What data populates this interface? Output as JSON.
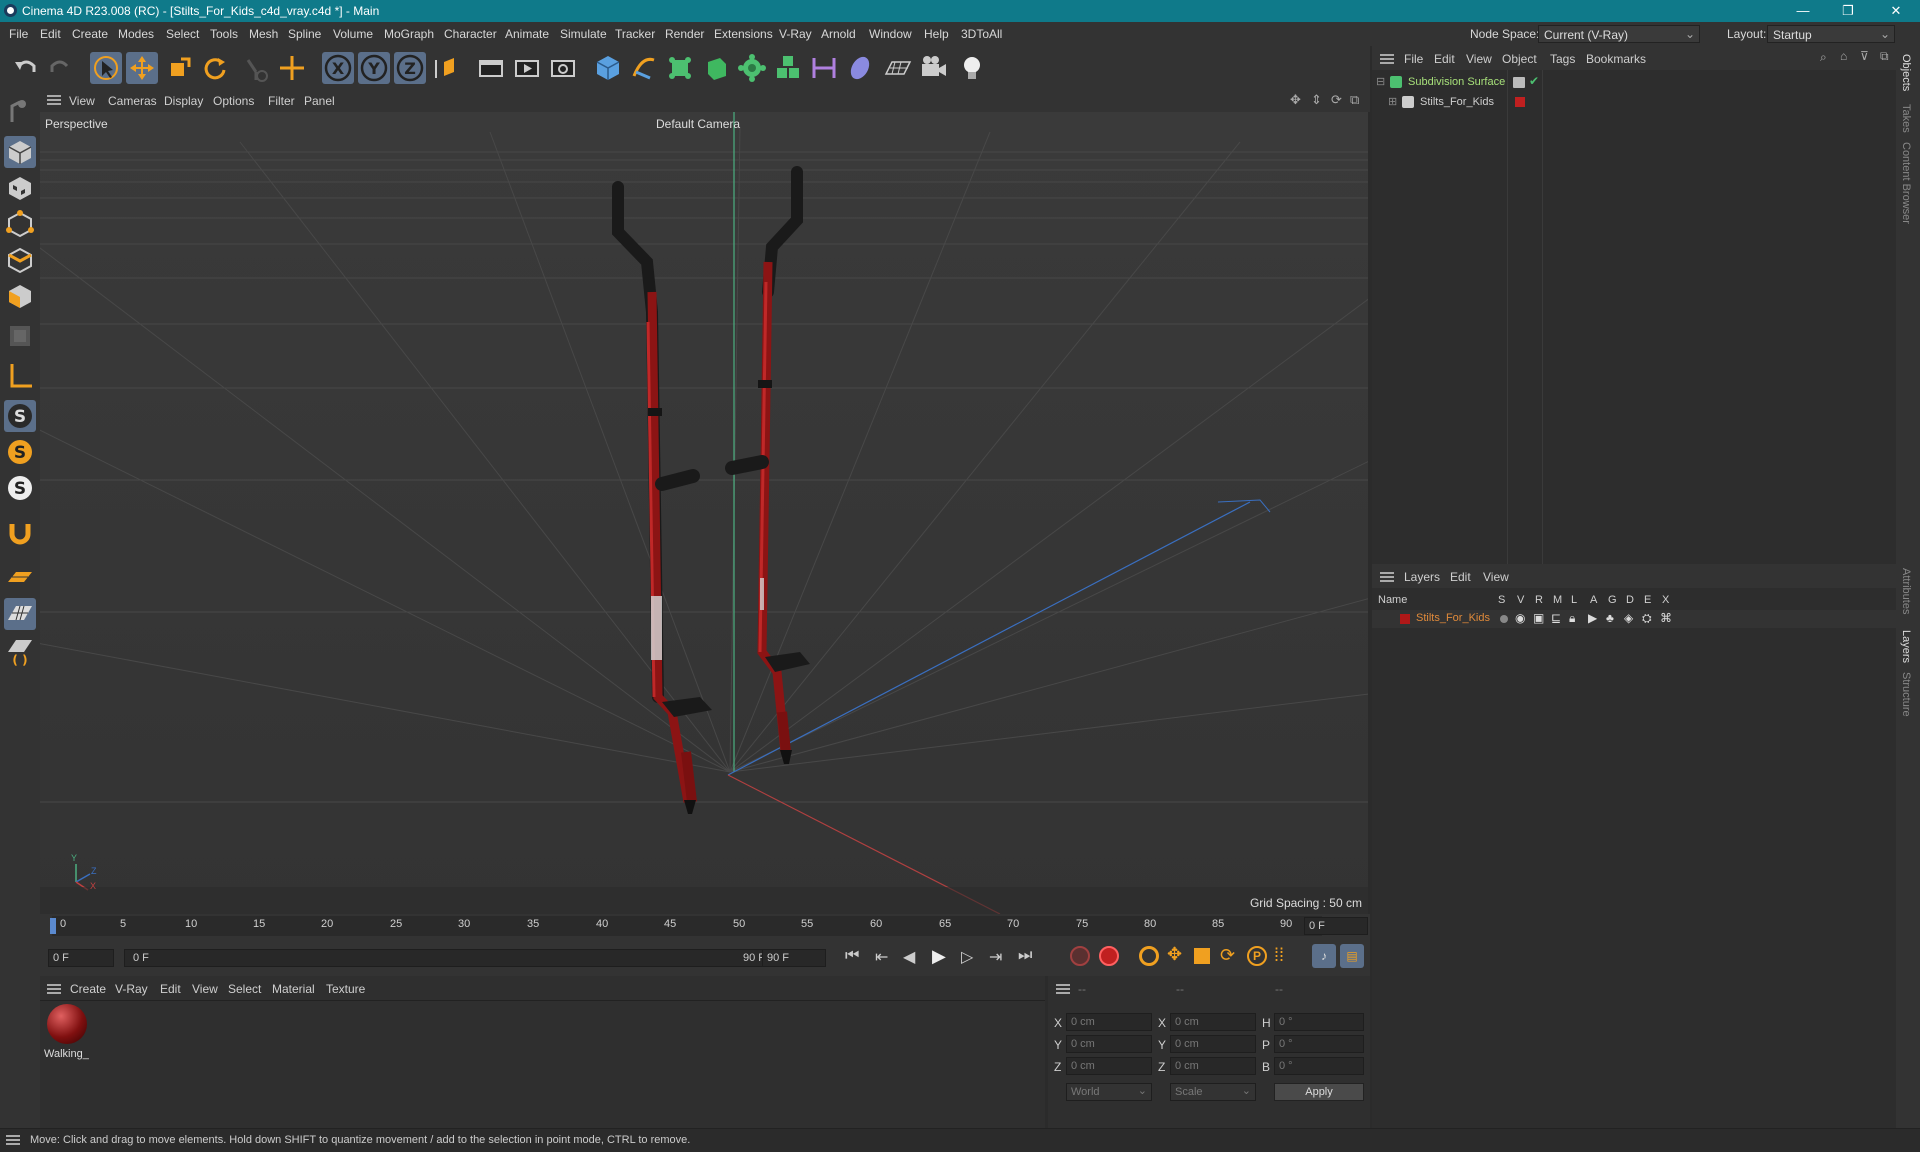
{
  "window": {
    "title": "Cinema 4D R23.008 (RC) - [Stilts_For_Kids_c4d_vray.c4d *] - Main",
    "minimize": "—",
    "restore": "❐",
    "close": "✕"
  },
  "menu": [
    "File",
    "Edit",
    "Create",
    "Modes",
    "Select",
    "Tools",
    "Mesh",
    "Spline",
    "Volume",
    "MoGraph",
    "Character",
    "Animate",
    "Simulate",
    "Tracker",
    "Render",
    "Extensions",
    "V-Ray",
    "Arnold",
    "Window",
    "Help",
    "3DToAll"
  ],
  "node_space": {
    "label": "Node Space:",
    "value": "Current (V-Ray)"
  },
  "layout": {
    "label": "Layout:",
    "value": "Startup"
  },
  "viewport_menu": [
    "View",
    "Cameras",
    "Display",
    "Options",
    "Filter",
    "Panel"
  ],
  "viewport": {
    "name": "Perspective",
    "camera": "Default Camera",
    "grid_spacing": "Grid Spacing : 50 cm",
    "axis_y": "Y",
    "axis_z": "Z",
    "axis_x": "X"
  },
  "timeline": {
    "ticks": [
      "0",
      "5",
      "10",
      "15",
      "20",
      "25",
      "30",
      "35",
      "40",
      "45",
      "50",
      "55",
      "60",
      "65",
      "70",
      "75",
      "80",
      "85",
      "90"
    ],
    "current_frame": "0 F"
  },
  "transport": {
    "start_field": "0 F",
    "range_start": "0 F",
    "range_end": "90 F",
    "end_field": "90 F"
  },
  "material_menu": [
    "Create",
    "V-Ray",
    "Edit",
    "View",
    "Select",
    "Material",
    "Texture"
  ],
  "material": {
    "name": "Walking_"
  },
  "coords": {
    "headers": [
      "--",
      "--",
      "--"
    ],
    "rows": [
      {
        "l1": "X",
        "v1": "0 cm",
        "l2": "X",
        "v2": "0 cm",
        "l3": "H",
        "v3": "0 °"
      },
      {
        "l1": "Y",
        "v1": "0 cm",
        "l2": "Y",
        "v2": "0 cm",
        "l3": "P",
        "v3": "0 °"
      },
      {
        "l1": "Z",
        "v1": "0 cm",
        "l2": "Z",
        "v2": "0 cm",
        "l3": "B",
        "v3": "0 °"
      }
    ],
    "mode1": "World",
    "mode2": "Scale",
    "apply": "Apply"
  },
  "object_menu": [
    "File",
    "Edit",
    "View",
    "Object",
    "Tags",
    "Bookmarks"
  ],
  "objects": [
    {
      "name": "Subdivision Surface",
      "color": "#a7e07a"
    },
    {
      "name": "Stilts_For_Kids",
      "color": "#cfcfcf"
    }
  ],
  "layers_menu": [
    "Layers",
    "Edit",
    "View"
  ],
  "layers_header": {
    "name": "Name",
    "cols": [
      "S",
      "V",
      "R",
      "M",
      "L",
      "A",
      "G",
      "D",
      "E",
      "X"
    ]
  },
  "layers": [
    {
      "name": "Stilts_For_Kids",
      "color": "#e08a3a"
    }
  ],
  "right_tabs": [
    "Objects",
    "Takes",
    "Content Browser",
    "Attributes",
    "Layers",
    "Structure"
  ],
  "status": "Move: Click and drag to move elements. Hold down SHIFT to quantize movement / add to the selection in point mode, CTRL to remove.",
  "colors": {
    "accent": "#0f7a8a",
    "stilt_red": "#a01818",
    "orange": "#f0a020"
  }
}
